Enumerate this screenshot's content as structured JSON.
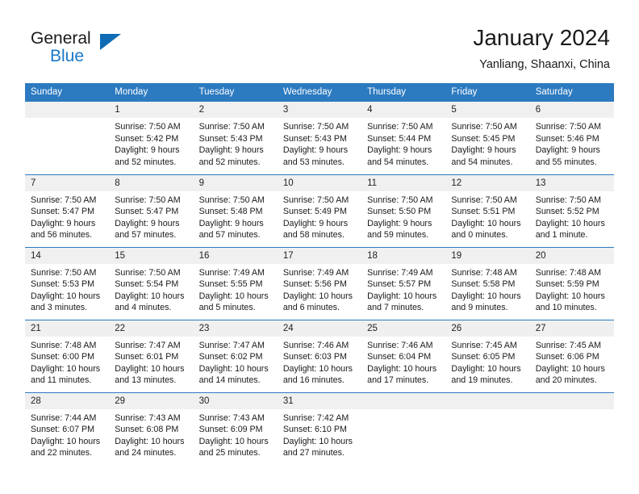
{
  "brand": {
    "name_part1": "General",
    "name_part2": "Blue",
    "accent_color": "#1878c8",
    "triangle_color": "#0f6cb4"
  },
  "header": {
    "title": "January 2024",
    "subtitle": "Yanliang, Shaanxi, China"
  },
  "calendar": {
    "header_bg": "#2c7ac0",
    "daynum_bg": "#f0f0f0",
    "weekdays": [
      "Sunday",
      "Monday",
      "Tuesday",
      "Wednesday",
      "Thursday",
      "Friday",
      "Saturday"
    ],
    "weeks": [
      [
        {
          "day": "",
          "sunrise": "",
          "sunset": "",
          "daylight1": "",
          "daylight2": "",
          "empty": true
        },
        {
          "day": "1",
          "sunrise": "Sunrise: 7:50 AM",
          "sunset": "Sunset: 5:42 PM",
          "daylight1": "Daylight: 9 hours",
          "daylight2": "and 52 minutes."
        },
        {
          "day": "2",
          "sunrise": "Sunrise: 7:50 AM",
          "sunset": "Sunset: 5:43 PM",
          "daylight1": "Daylight: 9 hours",
          "daylight2": "and 52 minutes."
        },
        {
          "day": "3",
          "sunrise": "Sunrise: 7:50 AM",
          "sunset": "Sunset: 5:43 PM",
          "daylight1": "Daylight: 9 hours",
          "daylight2": "and 53 minutes."
        },
        {
          "day": "4",
          "sunrise": "Sunrise: 7:50 AM",
          "sunset": "Sunset: 5:44 PM",
          "daylight1": "Daylight: 9 hours",
          "daylight2": "and 54 minutes."
        },
        {
          "day": "5",
          "sunrise": "Sunrise: 7:50 AM",
          "sunset": "Sunset: 5:45 PM",
          "daylight1": "Daylight: 9 hours",
          "daylight2": "and 54 minutes."
        },
        {
          "day": "6",
          "sunrise": "Sunrise: 7:50 AM",
          "sunset": "Sunset: 5:46 PM",
          "daylight1": "Daylight: 9 hours",
          "daylight2": "and 55 minutes."
        }
      ],
      [
        {
          "day": "7",
          "sunrise": "Sunrise: 7:50 AM",
          "sunset": "Sunset: 5:47 PM",
          "daylight1": "Daylight: 9 hours",
          "daylight2": "and 56 minutes."
        },
        {
          "day": "8",
          "sunrise": "Sunrise: 7:50 AM",
          "sunset": "Sunset: 5:47 PM",
          "daylight1": "Daylight: 9 hours",
          "daylight2": "and 57 minutes."
        },
        {
          "day": "9",
          "sunrise": "Sunrise: 7:50 AM",
          "sunset": "Sunset: 5:48 PM",
          "daylight1": "Daylight: 9 hours",
          "daylight2": "and 57 minutes."
        },
        {
          "day": "10",
          "sunrise": "Sunrise: 7:50 AM",
          "sunset": "Sunset: 5:49 PM",
          "daylight1": "Daylight: 9 hours",
          "daylight2": "and 58 minutes."
        },
        {
          "day": "11",
          "sunrise": "Sunrise: 7:50 AM",
          "sunset": "Sunset: 5:50 PM",
          "daylight1": "Daylight: 9 hours",
          "daylight2": "and 59 minutes."
        },
        {
          "day": "12",
          "sunrise": "Sunrise: 7:50 AM",
          "sunset": "Sunset: 5:51 PM",
          "daylight1": "Daylight: 10 hours",
          "daylight2": "and 0 minutes."
        },
        {
          "day": "13",
          "sunrise": "Sunrise: 7:50 AM",
          "sunset": "Sunset: 5:52 PM",
          "daylight1": "Daylight: 10 hours",
          "daylight2": "and 1 minute."
        }
      ],
      [
        {
          "day": "14",
          "sunrise": "Sunrise: 7:50 AM",
          "sunset": "Sunset: 5:53 PM",
          "daylight1": "Daylight: 10 hours",
          "daylight2": "and 3 minutes."
        },
        {
          "day": "15",
          "sunrise": "Sunrise: 7:50 AM",
          "sunset": "Sunset: 5:54 PM",
          "daylight1": "Daylight: 10 hours",
          "daylight2": "and 4 minutes."
        },
        {
          "day": "16",
          "sunrise": "Sunrise: 7:49 AM",
          "sunset": "Sunset: 5:55 PM",
          "daylight1": "Daylight: 10 hours",
          "daylight2": "and 5 minutes."
        },
        {
          "day": "17",
          "sunrise": "Sunrise: 7:49 AM",
          "sunset": "Sunset: 5:56 PM",
          "daylight1": "Daylight: 10 hours",
          "daylight2": "and 6 minutes."
        },
        {
          "day": "18",
          "sunrise": "Sunrise: 7:49 AM",
          "sunset": "Sunset: 5:57 PM",
          "daylight1": "Daylight: 10 hours",
          "daylight2": "and 7 minutes."
        },
        {
          "day": "19",
          "sunrise": "Sunrise: 7:48 AM",
          "sunset": "Sunset: 5:58 PM",
          "daylight1": "Daylight: 10 hours",
          "daylight2": "and 9 minutes."
        },
        {
          "day": "20",
          "sunrise": "Sunrise: 7:48 AM",
          "sunset": "Sunset: 5:59 PM",
          "daylight1": "Daylight: 10 hours",
          "daylight2": "and 10 minutes."
        }
      ],
      [
        {
          "day": "21",
          "sunrise": "Sunrise: 7:48 AM",
          "sunset": "Sunset: 6:00 PM",
          "daylight1": "Daylight: 10 hours",
          "daylight2": "and 11 minutes."
        },
        {
          "day": "22",
          "sunrise": "Sunrise: 7:47 AM",
          "sunset": "Sunset: 6:01 PM",
          "daylight1": "Daylight: 10 hours",
          "daylight2": "and 13 minutes."
        },
        {
          "day": "23",
          "sunrise": "Sunrise: 7:47 AM",
          "sunset": "Sunset: 6:02 PM",
          "daylight1": "Daylight: 10 hours",
          "daylight2": "and 14 minutes."
        },
        {
          "day": "24",
          "sunrise": "Sunrise: 7:46 AM",
          "sunset": "Sunset: 6:03 PM",
          "daylight1": "Daylight: 10 hours",
          "daylight2": "and 16 minutes."
        },
        {
          "day": "25",
          "sunrise": "Sunrise: 7:46 AM",
          "sunset": "Sunset: 6:04 PM",
          "daylight1": "Daylight: 10 hours",
          "daylight2": "and 17 minutes."
        },
        {
          "day": "26",
          "sunrise": "Sunrise: 7:45 AM",
          "sunset": "Sunset: 6:05 PM",
          "daylight1": "Daylight: 10 hours",
          "daylight2": "and 19 minutes."
        },
        {
          "day": "27",
          "sunrise": "Sunrise: 7:45 AM",
          "sunset": "Sunset: 6:06 PM",
          "daylight1": "Daylight: 10 hours",
          "daylight2": "and 20 minutes."
        }
      ],
      [
        {
          "day": "28",
          "sunrise": "Sunrise: 7:44 AM",
          "sunset": "Sunset: 6:07 PM",
          "daylight1": "Daylight: 10 hours",
          "daylight2": "and 22 minutes."
        },
        {
          "day": "29",
          "sunrise": "Sunrise: 7:43 AM",
          "sunset": "Sunset: 6:08 PM",
          "daylight1": "Daylight: 10 hours",
          "daylight2": "and 24 minutes."
        },
        {
          "day": "30",
          "sunrise": "Sunrise: 7:43 AM",
          "sunset": "Sunset: 6:09 PM",
          "daylight1": "Daylight: 10 hours",
          "daylight2": "and 25 minutes."
        },
        {
          "day": "31",
          "sunrise": "Sunrise: 7:42 AM",
          "sunset": "Sunset: 6:10 PM",
          "daylight1": "Daylight: 10 hours",
          "daylight2": "and 27 minutes."
        },
        {
          "day": "",
          "sunrise": "",
          "sunset": "",
          "daylight1": "",
          "daylight2": "",
          "empty": true
        },
        {
          "day": "",
          "sunrise": "",
          "sunset": "",
          "daylight1": "",
          "daylight2": "",
          "empty": true
        },
        {
          "day": "",
          "sunrise": "",
          "sunset": "",
          "daylight1": "",
          "daylight2": "",
          "empty": true
        }
      ]
    ]
  }
}
